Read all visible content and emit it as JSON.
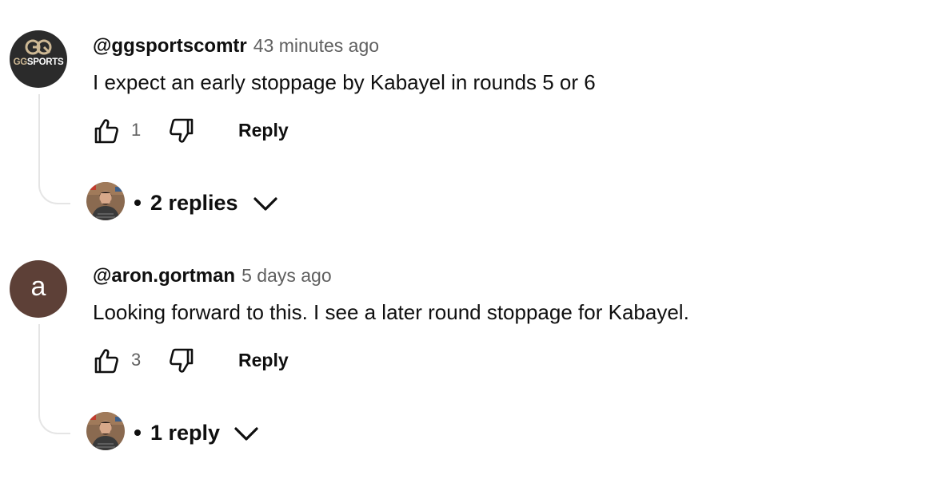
{
  "comments": [
    {
      "author": "@ggsportscomtr",
      "timestamp": "43 minutes ago",
      "text": "I expect an early stoppage by Kabayel in rounds 5 or 6",
      "avatar": {
        "type": "logo",
        "text_gg": "GG",
        "text_sports": "SPORTS",
        "bg_color": "#2b2b2b",
        "accent_color": "#cdb894"
      },
      "likes": "1",
      "reply_label": "Reply",
      "replies": {
        "label": "2 replies"
      }
    },
    {
      "author": "@aron.gortman",
      "timestamp": "5 days ago",
      "text": "Looking forward to this. I see a later round stoppage for Kabayel.",
      "avatar": {
        "type": "letter",
        "letter": "a",
        "bg_color": "#5d4037"
      },
      "likes": "3",
      "reply_label": "Reply",
      "replies": {
        "label": "1 reply"
      }
    }
  ],
  "icons": {
    "like": "thumbs-up-icon",
    "dislike": "thumbs-down-icon",
    "expand": "chevron-down-icon"
  }
}
